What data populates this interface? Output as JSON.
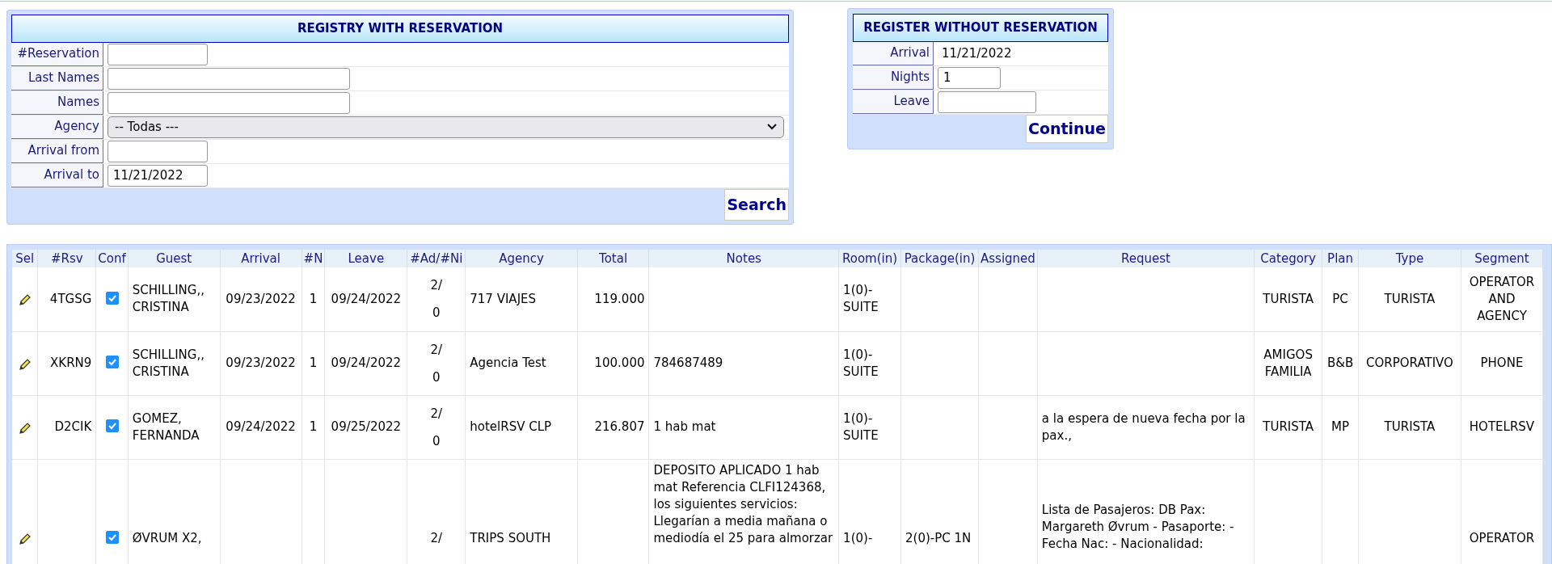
{
  "reservation_form": {
    "title": "REGISTRY WITH RESERVATION",
    "fields": [
      {
        "label": "#Reservation",
        "kind": "short"
      },
      {
        "label": "Last Names",
        "kind": "long"
      },
      {
        "label": "Names",
        "kind": "long"
      },
      {
        "label": "Agency",
        "kind": "select",
        "value": "-- Todas ---"
      },
      {
        "label": "Arrival from",
        "kind": "short"
      },
      {
        "label": "Arrival to",
        "kind": "short",
        "value": "11/21/2022"
      }
    ],
    "button": "Search"
  },
  "walkin_form": {
    "title": "REGISTER WITHOUT RESERVATION",
    "fields": [
      {
        "label": "Arrival",
        "kind": "text",
        "value": "11/21/2022"
      },
      {
        "label": "Nights",
        "kind": "short",
        "value": "1"
      },
      {
        "label": "Leave",
        "kind": "long"
      }
    ],
    "button": "Continue"
  },
  "table": {
    "columns": [
      {
        "label": "Sel"
      },
      {
        "label": "#Rsv"
      },
      {
        "label": "Conf"
      },
      {
        "label": "Guest"
      },
      {
        "label": "Arrival"
      },
      {
        "label": "#N"
      },
      {
        "label": "Leave"
      },
      {
        "label": "#Ad/#Ni"
      },
      {
        "label": "Agency"
      },
      {
        "label": "Total"
      },
      {
        "label": "Notes"
      },
      {
        "label": "Room(in)"
      },
      {
        "label": "Package(in)"
      },
      {
        "label": "Assigned"
      },
      {
        "label": "Request"
      },
      {
        "label": "Category"
      },
      {
        "label": "Plan"
      },
      {
        "label": "Type"
      },
      {
        "label": "Segment"
      }
    ],
    "rows": [
      {
        "kind": "full",
        "confirmed": true,
        "rsv": "4TGSG",
        "guest": "SCHILLING,, CRISTINA",
        "arrival": "09/23/2022",
        "nights": "1",
        "leave": "09/24/2022",
        "pax": "2/\n0",
        "agency": "717 VIAJES",
        "total": "119.000",
        "room": "1(0)- SUITE",
        "category": "TURISTA",
        "plan": "PC",
        "type": "TURISTA",
        "segment": "OPERATOR AND AGENCY"
      },
      {
        "kind": "full",
        "confirmed": true,
        "rsv": "XKRN9",
        "guest": "SCHILLING,, CRISTINA",
        "arrival": "09/23/2022",
        "nights": "1",
        "leave": "09/24/2022",
        "pax": "2/\n0",
        "agency": "Agencia Test",
        "total": "100.000",
        "notes": "784687489",
        "room": "1(0)- SUITE",
        "category": "AMIGOS FAMILIA",
        "plan": "B&B",
        "type": "CORPORATIVO",
        "segment": "PHONE"
      },
      {
        "kind": "full",
        "confirmed": true,
        "rsv": "D2CIK",
        "guest": "GOMEZ, FERNANDA",
        "arrival": "09/24/2022",
        "nights": "1",
        "leave": "09/25/2022",
        "pax": "2/\n0",
        "agency": "hotelRSV CLP",
        "total": "216.807",
        "notes": "1 hab mat",
        "room": "1(0)- SUITE",
        "request": "a la espera de nueva fecha por la pax.,",
        "category": "TURISTA",
        "plan": "MP",
        "type": "TURISTA",
        "segment": "HOTELRSV"
      },
      {
        "kind": "cut",
        "confirmed": true,
        "guest": "ØVRUM X2,",
        "pax": "2/",
        "agency": "TRIPS SOUTH",
        "notes": "DEPOSITO APLICADO 1 hab mat Referencia CLFI124368, los siguientes servicios: Llegarían a media mañana o mediodía el 25 para almorzar",
        "room": "1(0)-",
        "package": "2(0)-PC 1N",
        "request": "Lista de Pasajeros: DB Pax: Margareth Øvrum - Pasaporte: - Fecha Nac: - Nacionalidad:",
        "segment": "OPERATOR"
      }
    ]
  }
}
